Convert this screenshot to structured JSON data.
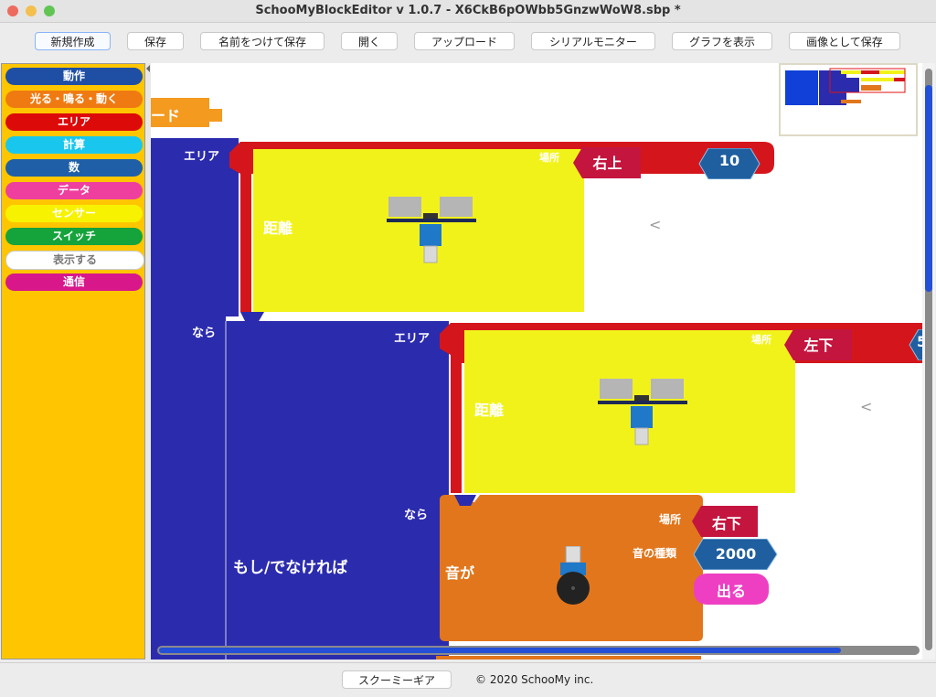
{
  "window": {
    "title": "SchooMyBlockEditor v 1.0.7 - X6CkB6pOWbb5GnzwWoW8.sbp *"
  },
  "toolbar": {
    "new": "新規作成",
    "save": "保存",
    "save_as": "名前をつけて保存",
    "open": "開く",
    "upload": "アップロード",
    "serial_monitor": "シリアルモニター",
    "show_graph": "グラフを表示",
    "save_image": "画像として保存"
  },
  "categories": [
    {
      "label": "動作",
      "color": "#1e4fa5"
    },
    {
      "label": "光る・鳴る・動く",
      "color": "#f07a12"
    },
    {
      "label": "エリア",
      "color": "#dd0a0a"
    },
    {
      "label": "計算",
      "color": "#19c7ee"
    },
    {
      "label": "数",
      "color": "#1e5fa8"
    },
    {
      "label": "データ",
      "color": "#ee3f9f"
    },
    {
      "label": "センサー",
      "color": "#f7f300"
    },
    {
      "label": "スイッチ",
      "color": "#15a33c"
    },
    {
      "label": "表示する",
      "color": "#ffffff"
    },
    {
      "label": "通信",
      "color": "#d7178a"
    }
  ],
  "blocks": {
    "partial_top": "ード",
    "if_else_outer": {
      "area_label": "エリア",
      "then_label": "なら",
      "title": "もし/でなければ"
    },
    "area1": {
      "place_label": "場所",
      "place": "右上",
      "value": "10",
      "sensor_label": "距離",
      "compare": "<"
    },
    "area2": {
      "area_label": "エリア",
      "place_label": "場所",
      "place": "左下",
      "value_partial": "5",
      "sensor_label": "距離",
      "compare": "<",
      "then_label": "なら"
    },
    "sound": {
      "title": "音が",
      "place_label": "場所",
      "place": "右下",
      "type_label": "音の種類",
      "type_value": "2000",
      "action": "出る"
    }
  },
  "footer": {
    "button": "スクーミーギア",
    "copyright": "© 2020 SchooMy inc."
  }
}
